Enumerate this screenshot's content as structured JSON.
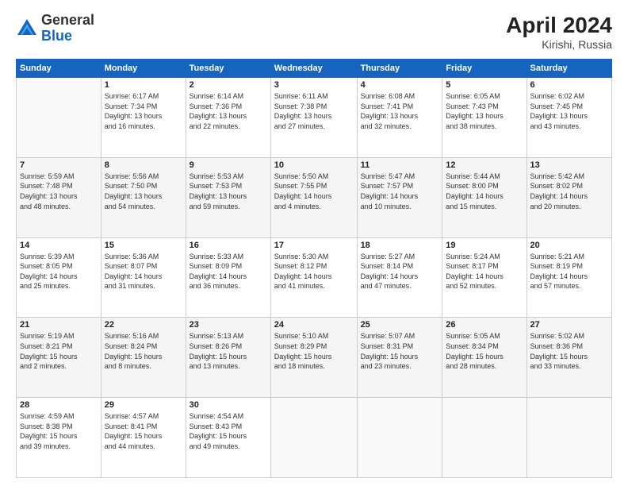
{
  "header": {
    "logo_general": "General",
    "logo_blue": "Blue",
    "month": "April 2024",
    "location": "Kirishi, Russia"
  },
  "days_of_week": [
    "Sunday",
    "Monday",
    "Tuesday",
    "Wednesday",
    "Thursday",
    "Friday",
    "Saturday"
  ],
  "weeks": [
    [
      {
        "day": "",
        "info": ""
      },
      {
        "day": "1",
        "info": "Sunrise: 6:17 AM\nSunset: 7:34 PM\nDaylight: 13 hours\nand 16 minutes."
      },
      {
        "day": "2",
        "info": "Sunrise: 6:14 AM\nSunset: 7:36 PM\nDaylight: 13 hours\nand 22 minutes."
      },
      {
        "day": "3",
        "info": "Sunrise: 6:11 AM\nSunset: 7:38 PM\nDaylight: 13 hours\nand 27 minutes."
      },
      {
        "day": "4",
        "info": "Sunrise: 6:08 AM\nSunset: 7:41 PM\nDaylight: 13 hours\nand 32 minutes."
      },
      {
        "day": "5",
        "info": "Sunrise: 6:05 AM\nSunset: 7:43 PM\nDaylight: 13 hours\nand 38 minutes."
      },
      {
        "day": "6",
        "info": "Sunrise: 6:02 AM\nSunset: 7:45 PM\nDaylight: 13 hours\nand 43 minutes."
      }
    ],
    [
      {
        "day": "7",
        "info": "Sunrise: 5:59 AM\nSunset: 7:48 PM\nDaylight: 13 hours\nand 48 minutes."
      },
      {
        "day": "8",
        "info": "Sunrise: 5:56 AM\nSunset: 7:50 PM\nDaylight: 13 hours\nand 54 minutes."
      },
      {
        "day": "9",
        "info": "Sunrise: 5:53 AM\nSunset: 7:53 PM\nDaylight: 13 hours\nand 59 minutes."
      },
      {
        "day": "10",
        "info": "Sunrise: 5:50 AM\nSunset: 7:55 PM\nDaylight: 14 hours\nand 4 minutes."
      },
      {
        "day": "11",
        "info": "Sunrise: 5:47 AM\nSunset: 7:57 PM\nDaylight: 14 hours\nand 10 minutes."
      },
      {
        "day": "12",
        "info": "Sunrise: 5:44 AM\nSunset: 8:00 PM\nDaylight: 14 hours\nand 15 minutes."
      },
      {
        "day": "13",
        "info": "Sunrise: 5:42 AM\nSunset: 8:02 PM\nDaylight: 14 hours\nand 20 minutes."
      }
    ],
    [
      {
        "day": "14",
        "info": "Sunrise: 5:39 AM\nSunset: 8:05 PM\nDaylight: 14 hours\nand 25 minutes."
      },
      {
        "day": "15",
        "info": "Sunrise: 5:36 AM\nSunset: 8:07 PM\nDaylight: 14 hours\nand 31 minutes."
      },
      {
        "day": "16",
        "info": "Sunrise: 5:33 AM\nSunset: 8:09 PM\nDaylight: 14 hours\nand 36 minutes."
      },
      {
        "day": "17",
        "info": "Sunrise: 5:30 AM\nSunset: 8:12 PM\nDaylight: 14 hours\nand 41 minutes."
      },
      {
        "day": "18",
        "info": "Sunrise: 5:27 AM\nSunset: 8:14 PM\nDaylight: 14 hours\nand 47 minutes."
      },
      {
        "day": "19",
        "info": "Sunrise: 5:24 AM\nSunset: 8:17 PM\nDaylight: 14 hours\nand 52 minutes."
      },
      {
        "day": "20",
        "info": "Sunrise: 5:21 AM\nSunset: 8:19 PM\nDaylight: 14 hours\nand 57 minutes."
      }
    ],
    [
      {
        "day": "21",
        "info": "Sunrise: 5:19 AM\nSunset: 8:21 PM\nDaylight: 15 hours\nand 2 minutes."
      },
      {
        "day": "22",
        "info": "Sunrise: 5:16 AM\nSunset: 8:24 PM\nDaylight: 15 hours\nand 8 minutes."
      },
      {
        "day": "23",
        "info": "Sunrise: 5:13 AM\nSunset: 8:26 PM\nDaylight: 15 hours\nand 13 minutes."
      },
      {
        "day": "24",
        "info": "Sunrise: 5:10 AM\nSunset: 8:29 PM\nDaylight: 15 hours\nand 18 minutes."
      },
      {
        "day": "25",
        "info": "Sunrise: 5:07 AM\nSunset: 8:31 PM\nDaylight: 15 hours\nand 23 minutes."
      },
      {
        "day": "26",
        "info": "Sunrise: 5:05 AM\nSunset: 8:34 PM\nDaylight: 15 hours\nand 28 minutes."
      },
      {
        "day": "27",
        "info": "Sunrise: 5:02 AM\nSunset: 8:36 PM\nDaylight: 15 hours\nand 33 minutes."
      }
    ],
    [
      {
        "day": "28",
        "info": "Sunrise: 4:59 AM\nSunset: 8:38 PM\nDaylight: 15 hours\nand 39 minutes."
      },
      {
        "day": "29",
        "info": "Sunrise: 4:57 AM\nSunset: 8:41 PM\nDaylight: 15 hours\nand 44 minutes."
      },
      {
        "day": "30",
        "info": "Sunrise: 4:54 AM\nSunset: 8:43 PM\nDaylight: 15 hours\nand 49 minutes."
      },
      {
        "day": "",
        "info": ""
      },
      {
        "day": "",
        "info": ""
      },
      {
        "day": "",
        "info": ""
      },
      {
        "day": "",
        "info": ""
      }
    ]
  ]
}
